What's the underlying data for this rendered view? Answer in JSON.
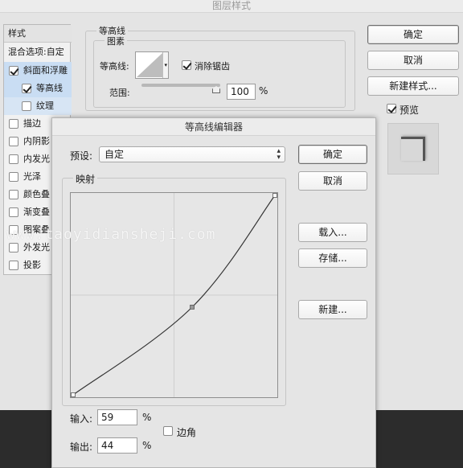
{
  "main_dialog": {
    "title": "图层样式",
    "sidebar": {
      "header": "样式",
      "blend_options": "混合选项:自定",
      "items": [
        {
          "label": "斜面和浮雕",
          "checked": true
        },
        {
          "label": "等高线",
          "checked": true
        },
        {
          "label": "纹理",
          "checked": false
        },
        {
          "label": "描边",
          "checked": false
        },
        {
          "label": "内阴影",
          "checked": false
        },
        {
          "label": "内发光",
          "checked": false
        },
        {
          "label": "光泽",
          "checked": false
        },
        {
          "label": "颜色叠",
          "checked": false
        },
        {
          "label": "渐变叠",
          "checked": false
        },
        {
          "label": "图案叠",
          "checked": false
        },
        {
          "label": "外发光",
          "checked": false
        },
        {
          "label": "投影",
          "checked": false
        }
      ]
    },
    "contour_panel": {
      "group_title": "等高线",
      "subgroup_title": "图素",
      "contour_label": "等高线:",
      "antialias_label": "消除锯齿",
      "antialias_checked": true,
      "range_label": "范围:",
      "range_value": "100",
      "range_unit": "%",
      "range_slider_fraction": 1.0
    },
    "buttons": {
      "ok": "确定",
      "cancel": "取消",
      "new_style": "新建样式...",
      "preview_label": "预览",
      "preview_checked": true
    }
  },
  "contour_editor": {
    "title": "等高线编辑器",
    "preset_label": "预设:",
    "preset_value": "自定",
    "mapping_label": "映射",
    "buttons": {
      "ok": "确定",
      "cancel": "取消",
      "load": "载入...",
      "save": "存储...",
      "new": "新建..."
    },
    "input_label": "输入:",
    "input_value": "59",
    "output_label": "输出:",
    "output_value": "44",
    "percent": "%",
    "corner_label": "边角",
    "corner_checked": false,
    "curve_points": [
      {
        "input": 0,
        "output": 0
      },
      {
        "input": 59,
        "output": 44
      },
      {
        "input": 100,
        "output": 100
      }
    ]
  },
  "watermark": "www.taoyidiansheji.com",
  "colors": {
    "dialog_bg": "#e4e4e4",
    "sidebar_selected": "#c9ddf3",
    "dark_background": "#2c2c2c"
  }
}
